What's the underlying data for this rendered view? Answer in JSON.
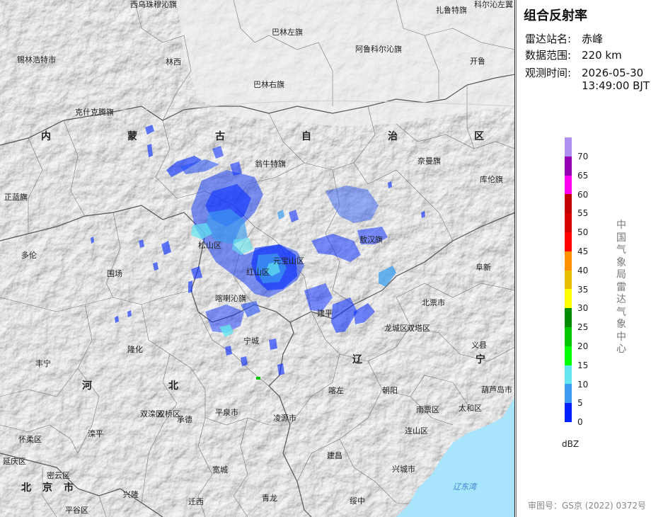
{
  "panel": {
    "title": "组合反射率",
    "station_label": "雷达站名:",
    "station_value": "赤峰",
    "range_label": "数据范围:",
    "range_value": "220 km",
    "time_label": "观测时间:",
    "time_value_line1": "2026-05-30",
    "time_value_line2": "13:49:00 BJT",
    "source_vertical": "中国气象局雷达气象中心",
    "approval": "审图号：GS京 (2022) 0372号",
    "unit": "dBZ"
  },
  "legend": [
    {
      "label": "70",
      "color": "#ad90f0"
    },
    {
      "label": "65",
      "color": "#9600b4"
    },
    {
      "label": "60",
      "color": "#ff00f0"
    },
    {
      "label": "55",
      "color": "#c00000"
    },
    {
      "label": "50",
      "color": "#d60000"
    },
    {
      "label": "45",
      "color": "#ff0000"
    },
    {
      "label": "40",
      "color": "#ff9000"
    },
    {
      "label": "35",
      "color": "#e7c000"
    },
    {
      "label": "30",
      "color": "#ffff00"
    },
    {
      "label": "25",
      "color": "#008c00"
    },
    {
      "label": "20",
      "color": "#00c800"
    },
    {
      "label": "15",
      "color": "#00ff00"
    },
    {
      "label": "10",
      "color": "#63e6f0"
    },
    {
      "label": "5",
      "color": "#3c9df0"
    },
    {
      "label": "0",
      "color": "#0020ff"
    }
  ],
  "map": {
    "places": [
      "西乌珠穆沁旗",
      "科尔沁左翼",
      "扎鲁特旗",
      "巴林左旗",
      "阿鲁科尔沁旗",
      "锡林浩特市",
      "林西",
      "开鲁",
      "巴林右旗",
      "克什克腾旗",
      "翁牛特旗",
      "奈曼旗",
      "库伦旗",
      "正蓝旗",
      "敖汉旗",
      "多伦",
      "松山区",
      "红山区",
      "元宝山区",
      "阜新",
      "围场",
      "喀喇沁旗",
      "建平",
      "北票市",
      "龙城区",
      "双塔区",
      "宁城",
      "义县",
      "隆化",
      "丰宁",
      "承德",
      "双滦区",
      "双桥区",
      "平泉市",
      "凌源市",
      "喀左",
      "朝阳",
      "南票区",
      "太和区",
      "葫芦岛市",
      "滦平",
      "怀柔区",
      "延庆区",
      "密云区",
      "兴隆",
      "宽城",
      "建昌",
      "连山区",
      "兴城市",
      "平谷区",
      "迁西",
      "青龙",
      "绥中"
    ],
    "regions": [
      "内",
      "蒙",
      "古",
      "自",
      "治",
      "区",
      "河",
      "北",
      "辽",
      "宁",
      "北",
      "京",
      "市"
    ],
    "sea": "辽东湾"
  }
}
